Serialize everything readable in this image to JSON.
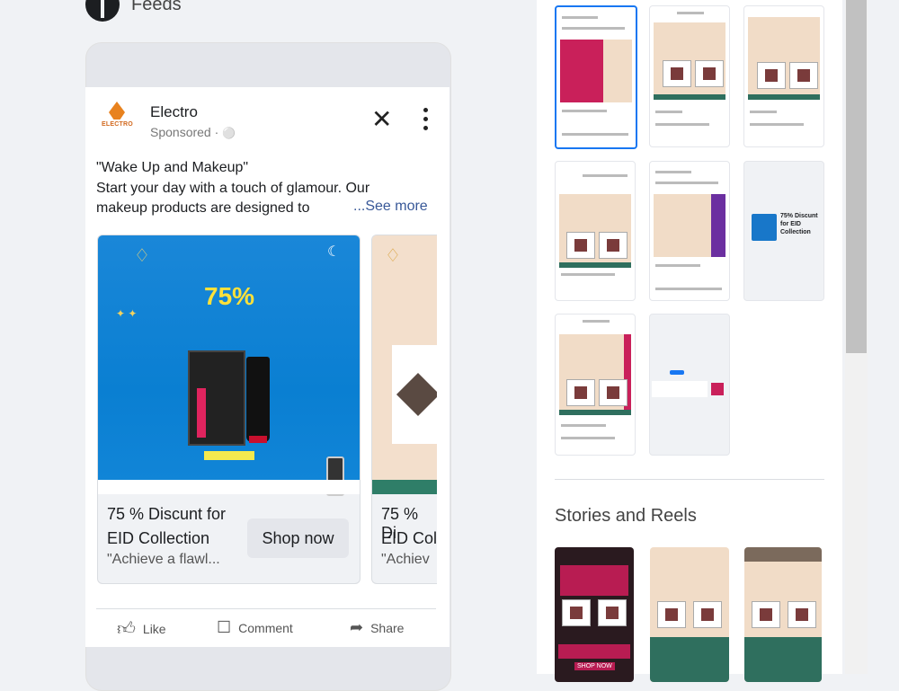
{
  "header": {
    "title": "Feeds"
  },
  "post": {
    "page_name": "Electro",
    "logo_text": "ELECTRO",
    "sponsored": "Sponsored · ",
    "body_line1": "\"Wake Up and Makeup\"",
    "body_line2": "Start your day with a touch of glamour. Our",
    "body_line3": "makeup products are designed to",
    "see_more": "...See more",
    "cards": [
      {
        "headline1": "75 % Discunt for",
        "headline2": "EID Collection",
        "description": "\"Achieve a flawl...",
        "cta": "Shop now",
        "discount": "75%",
        "offer": "OFFER PRICE"
      },
      {
        "headline1": "75 % Di",
        "headline2": "EID Col",
        "description": "\"Achiev"
      }
    ],
    "actions": {
      "like": "Like",
      "comment": "Comment",
      "share": "Share"
    }
  },
  "right_panel": {
    "thumb_text": "75% Discunt for EID Collection",
    "stories_title": "Stories and Reels",
    "shop_now_mini": "SHOP NOW"
  },
  "colors": {
    "accent": "#1877f2",
    "ad_blue": "#0a7fd2",
    "green": "#2f7e68"
  }
}
